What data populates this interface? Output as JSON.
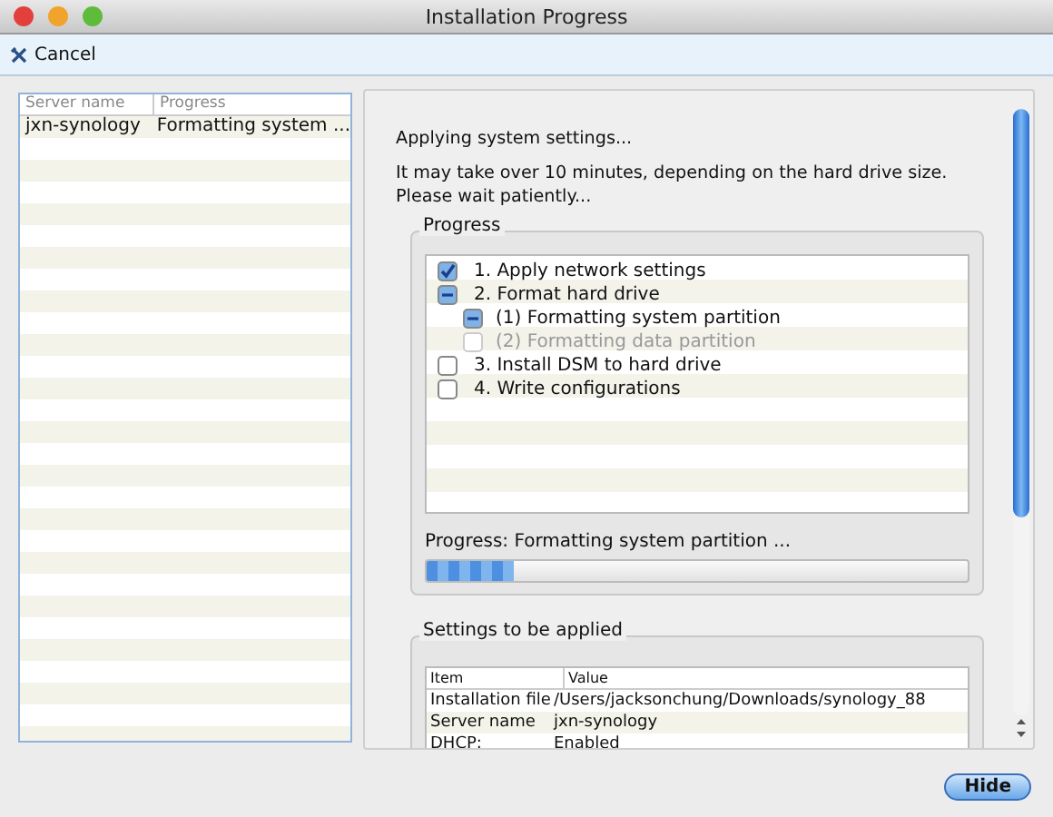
{
  "window": {
    "title": "Installation Progress"
  },
  "toolbar": {
    "cancel": "Cancel"
  },
  "server_list": {
    "columns": [
      "Server name",
      "Progress"
    ],
    "rows": [
      {
        "name": "jxn-synology",
        "progress": "Formatting system ...",
        "selected": false
      }
    ]
  },
  "details": {
    "heading": "Applying system settings...",
    "note": "It may take over 10 minutes, depending on the hard drive size. Please wait patiently...",
    "progress_group": {
      "legend": "Progress",
      "steps": [
        {
          "label": "1. Apply network settings",
          "checked": true,
          "mixed": false,
          "disabled": false
        },
        {
          "label": "2. Format hard drive",
          "checked": false,
          "mixed": true,
          "disabled": false,
          "children": [
            {
              "label": "(1) Formatting system partition",
              "checked": false,
              "mixed": true,
              "disabled": false
            },
            {
              "label": "(2) Formatting data partition",
              "checked": false,
              "mixed": false,
              "disabled": true
            }
          ]
        },
        {
          "label": "3. Install DSM to hard drive",
          "checked": false,
          "mixed": false,
          "disabled": false
        },
        {
          "label": "4. Write configurations",
          "checked": false,
          "mixed": false,
          "disabled": false
        }
      ],
      "status": "Progress: Formatting system partition ...",
      "level": 0.16
    },
    "settings_group": {
      "legend": "Settings to be applied",
      "columns": [
        "Item",
        "Value"
      ],
      "rows": [
        [
          "Installation file",
          "/Users/jacksonchung/Downloads/synology_88"
        ],
        [
          "Server name",
          "jxn-synology"
        ],
        [
          "DHCP:",
          "Enabled"
        ]
      ]
    }
  },
  "buttons": {
    "hide": "Hide"
  }
}
